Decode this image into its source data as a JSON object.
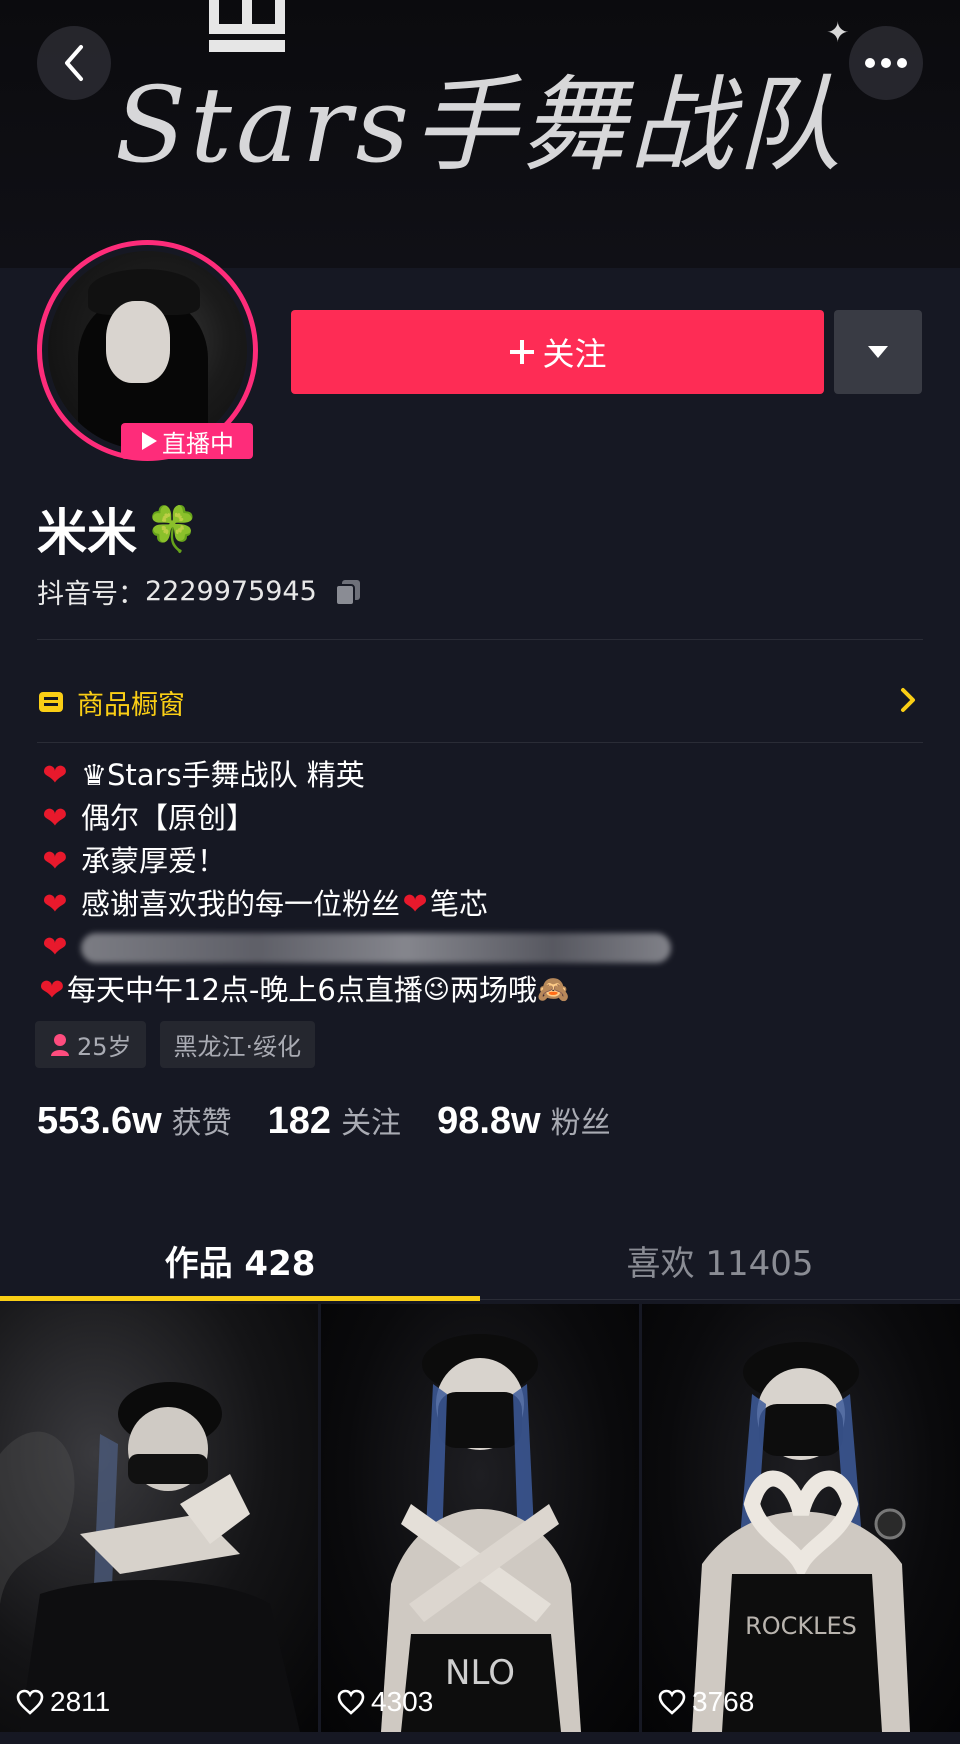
{
  "banner": {
    "title": "Stars手舞战队",
    "icons": [
      "crown-icon",
      "sparkle-icon"
    ]
  },
  "header": {
    "back_icon": "chevron-left-icon",
    "more_icon": "more-dots-icon"
  },
  "profile": {
    "live_badge": "直播中",
    "follow_label": "关注",
    "nickname": "米米",
    "nickname_emoji": "🍀",
    "douyin_id_label": "抖音号：",
    "douyin_id": "2229975945"
  },
  "shop": {
    "label": "商品橱窗"
  },
  "bio": {
    "line1": "♛Stars手舞战队 精英",
    "line2": "偶尔【原创】",
    "line3": "承蒙厚爱！",
    "line4a": "感谢喜欢我的每一位粉丝",
    "line4b": "笔芯",
    "line6a": "每天中午12点-晚上6点直播",
    "line6b": "两场哦"
  },
  "tags": {
    "age": "25岁",
    "location": "黑龙江·绥化"
  },
  "stats": {
    "likes_num": "553.6w",
    "likes_label": "获赞",
    "following_num": "182",
    "following_label": "关注",
    "followers_num": "98.8w",
    "followers_label": "粉丝"
  },
  "tabs": {
    "works": "作品 428",
    "liked": "喜欢 11405"
  },
  "videos": [
    {
      "likes": "2811"
    },
    {
      "likes": "4303"
    },
    {
      "likes": "3768"
    }
  ],
  "colors": {
    "background": "#161823",
    "follow_button": "#fe2c55",
    "live_badge": "#fe2c7a",
    "shop_accent": "#face15",
    "tab_indicator": "#face15"
  }
}
